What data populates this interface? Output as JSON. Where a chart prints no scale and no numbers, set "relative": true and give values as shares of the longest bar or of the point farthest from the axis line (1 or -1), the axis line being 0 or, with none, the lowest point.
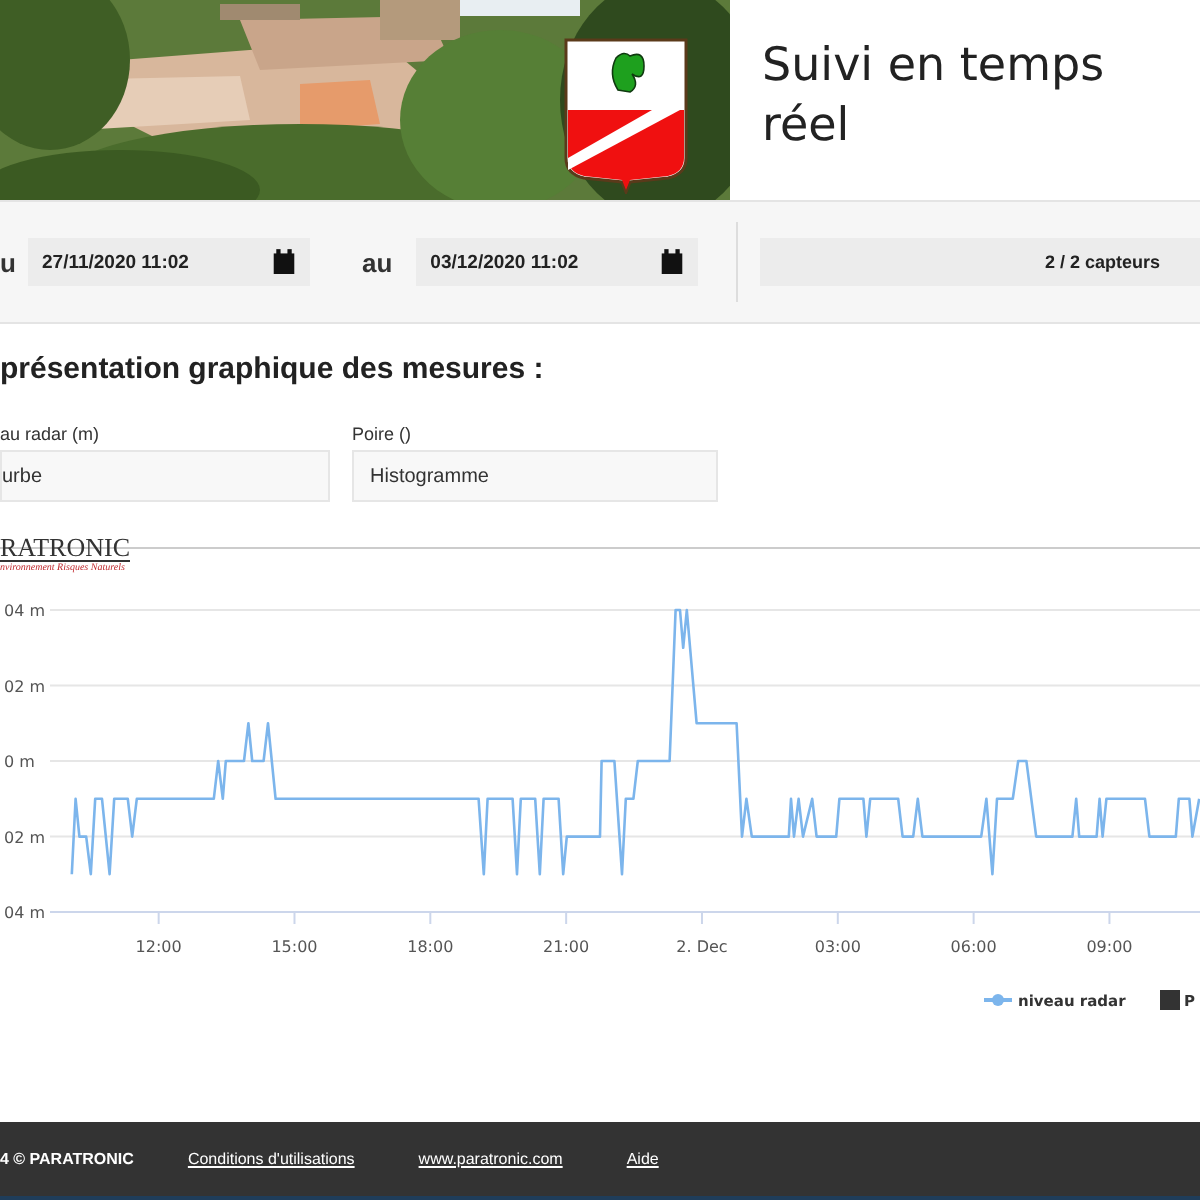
{
  "header": {
    "title": "Suivi en temps réel"
  },
  "period": {
    "from_label": "u",
    "from_value": "27/11/2020 11:02",
    "to_label": "au",
    "to_value": "03/12/2020 11:02",
    "sensors": "2 / 2 capteurs"
  },
  "section_title": "présentation graphique des mesures :",
  "selectors": [
    {
      "label": "au radar (m)",
      "value": "urbe"
    },
    {
      "label": "Poire ()",
      "value": "Histogramme"
    }
  ],
  "logo": {
    "name": "RATRONIC",
    "tagline": "nvironnement Risques Naturels"
  },
  "y_axis_labels": [
    "04 m",
    "02 m",
    "0 m",
    "02 m",
    "04 m"
  ],
  "legend_extra": [
    {
      "label": "P",
      "color": "#333333"
    }
  ],
  "chart_data": {
    "type": "line",
    "relative": true,
    "xlim": [
      "2020-12-01T09:36",
      "2020-12-02T11:00"
    ],
    "xticks": [
      {
        "value": "2020-12-01T12:00",
        "label": "12:00"
      },
      {
        "value": "2020-12-01T15:00",
        "label": "15:00"
      },
      {
        "value": "2020-12-01T18:00",
        "label": "18:00"
      },
      {
        "value": "2020-12-01T21:00",
        "label": "21:00"
      },
      {
        "value": "2020-12-02T00:00",
        "label": "2. Dec"
      },
      {
        "value": "2020-12-02T03:00",
        "label": "03:00"
      },
      {
        "value": "2020-12-02T06:00",
        "label": "06:00"
      },
      {
        "value": "2020-12-02T09:00",
        "label": "09:00"
      }
    ],
    "x": [
      "2020-12-01T10:05",
      "2020-12-01T10:10",
      "2020-12-01T10:15",
      "2020-12-01T10:24",
      "2020-12-01T10:30",
      "2020-12-01T10:36",
      "2020-12-01T10:45",
      "2020-12-01T10:55",
      "2020-12-01T11:01",
      "2020-12-01T11:19",
      "2020-12-01T11:25",
      "2020-12-01T11:31",
      "2020-12-01T13:13",
      "2020-12-01T13:19",
      "2020-12-01T13:25",
      "2020-12-01T13:29",
      "2020-12-01T13:53",
      "2020-12-01T13:59",
      "2020-12-01T14:04",
      "2020-12-01T14:19",
      "2020-12-01T14:25",
      "2020-12-01T14:35",
      "2020-12-01T19:04",
      "2020-12-01T19:11",
      "2020-12-01T19:16",
      "2020-12-01T19:49",
      "2020-12-01T19:55",
      "2020-12-01T20:00",
      "2020-12-01T20:19",
      "2020-12-01T20:25",
      "2020-12-01T20:30",
      "2020-12-01T20:50",
      "2020-12-01T20:56",
      "2020-12-01T21:01",
      "2020-12-01T21:45",
      "2020-12-01T21:47",
      "2020-12-01T22:04",
      "2020-12-01T22:14",
      "2020-12-01T22:19",
      "2020-12-01T22:29",
      "2020-12-01T22:35",
      "2020-12-01T23:17",
      "2020-12-01T23:25",
      "2020-12-01T23:31",
      "2020-12-01T23:35",
      "2020-12-01T23:40",
      "2020-12-01T23:53",
      "2020-12-02T00:46",
      "2020-12-02T00:53",
      "2020-12-02T00:59",
      "2020-12-02T01:06",
      "2020-12-02T01:55",
      "2020-12-02T01:58",
      "2020-12-02T02:02",
      "2020-12-02T02:08",
      "2020-12-02T02:14",
      "2020-12-02T02:26",
      "2020-12-02T02:32",
      "2020-12-02T02:58",
      "2020-12-02T03:02",
      "2020-12-02T03:34",
      "2020-12-02T03:38",
      "2020-12-02T03:43",
      "2020-12-02T03:56",
      "2020-12-02T04:20",
      "2020-12-02T04:26",
      "2020-12-02T04:40",
      "2020-12-02T04:46",
      "2020-12-02T04:52",
      "2020-12-02T06:10",
      "2020-12-02T06:17",
      "2020-12-02T06:25",
      "2020-12-02T06:31",
      "2020-12-02T06:52",
      "2020-12-02T06:59",
      "2020-12-02T07:10",
      "2020-12-02T07:23",
      "2020-12-02T08:11",
      "2020-12-02T08:16",
      "2020-12-02T08:20",
      "2020-12-02T08:43",
      "2020-12-02T08:47",
      "2020-12-02T08:51",
      "2020-12-02T08:56",
      "2020-12-02T09:47",
      "2020-12-02T09:53",
      "2020-12-02T10:28",
      "2020-12-02T10:32",
      "2020-12-02T10:46",
      "2020-12-02T10:50",
      "2020-12-02T10:59"
    ],
    "series": [
      {
        "name": "niveau radar",
        "color": "#7cb5ec",
        "values": [
          0.125,
          0.375,
          0.25,
          0.25,
          0.125,
          0.375,
          0.375,
          0.125,
          0.375,
          0.375,
          0.25,
          0.375,
          0.375,
          0.5,
          0.375,
          0.5,
          0.5,
          0.625,
          0.5,
          0.5,
          0.625,
          0.375,
          0.375,
          0.125,
          0.375,
          0.375,
          0.125,
          0.375,
          0.375,
          0.125,
          0.375,
          0.375,
          0.125,
          0.25,
          0.25,
          0.5,
          0.5,
          0.125,
          0.375,
          0.375,
          0.5,
          0.5,
          1,
          1,
          0.875,
          1,
          0.625,
          0.625,
          0.25,
          0.375,
          0.25,
          0.25,
          0.375,
          0.25,
          0.375,
          0.25,
          0.375,
          0.25,
          0.25,
          0.375,
          0.375,
          0.25,
          0.375,
          0.375,
          0.375,
          0.25,
          0.25,
          0.375,
          0.25,
          0.25,
          0.375,
          0.125,
          0.375,
          0.375,
          0.5,
          0.5,
          0.25,
          0.25,
          0.375,
          0.25,
          0.25,
          0.375,
          0.25,
          0.375,
          0.375,
          0.25,
          0.25,
          0.375,
          0.375,
          0.25,
          0.375
        ]
      }
    ]
  },
  "footer": {
    "copyright": "4 © PARATRONIC",
    "links": [
      "Conditions d'utilisations",
      "www.paratronic.com",
      "Aide"
    ]
  }
}
